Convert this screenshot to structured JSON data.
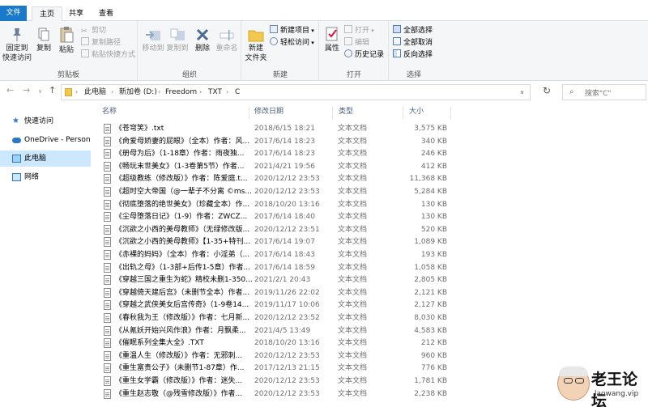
{
  "ribbon_tabs": {
    "file": "文件",
    "home": "主页",
    "share": "共享",
    "view": "查看"
  },
  "ribbon": {
    "clipboard": {
      "label": "剪贴板",
      "pin": "固定到\n快速访问",
      "copy": "复制",
      "paste": "粘贴",
      "cut": "剪切",
      "copy_path": "复制路径",
      "paste_shortcut": "粘贴快捷方式"
    },
    "organize": {
      "label": "组织",
      "move_to": "移动到",
      "copy_to": "复制到",
      "delete": "删除",
      "rename": "重命名"
    },
    "new": {
      "label": "新建",
      "new_folder": "新建\n文件夹",
      "new_item": "新建项目",
      "easy_access": "轻松访问"
    },
    "open": {
      "label": "打开",
      "properties": "属性",
      "open": "打开",
      "edit": "编辑",
      "history": "历史记录"
    },
    "select": {
      "label": "选择",
      "select_all": "全部选择",
      "select_none": "全部取消",
      "invert": "反向选择"
    }
  },
  "address": {
    "crumbs": [
      "此电脑",
      "新加卷 (D:)",
      "Freedom",
      "TXT",
      "C"
    ],
    "search_placeholder": "搜索\"C\""
  },
  "sidebar": {
    "items": [
      {
        "label": "快速访问",
        "icon": "star-icon"
      },
      {
        "label": "OneDrive - Personal",
        "icon": "cloud-icon"
      },
      {
        "label": "此电脑",
        "icon": "computer-icon",
        "selected": true
      },
      {
        "label": "网络",
        "icon": "network-icon"
      }
    ]
  },
  "columns": {
    "name": "名称",
    "date": "修改日期",
    "type": "类型",
    "size": "大小"
  },
  "files": [
    {
      "name": "《苍穹笑》.txt",
      "date": "2018/6/15 18:21",
      "type": "文本文档",
      "size": "3,575 KB"
    },
    {
      "name": "《肏爱母娇妻的屁眼》（全本）作者：风...",
      "date": "2017/6/14 18:23",
      "type": "文本文档",
      "size": "340 KB"
    },
    {
      "name": "《册母为后》（1-18章）作者：雨夜独...",
      "date": "2017/6/14 18:23",
      "type": "文本文档",
      "size": "246 KB"
    },
    {
      "name": "《畅玩末世美女》（1-3卷第5节）作者...",
      "date": "2021/4/21 19:56",
      "type": "文本文档",
      "size": "412 KB"
    },
    {
      "name": "《超级教练（修改版）》作者：陈爱庭.t...",
      "date": "2020/12/12 23:53",
      "type": "文本文档",
      "size": "11,368 KB"
    },
    {
      "name": "《超时空大帝国（@一辈子不分离 ©ms...",
      "date": "2020/12/12 23:53",
      "type": "文本文档",
      "size": "5,284 KB"
    },
    {
      "name": "《彻底堕落的绝世美女》（珍藏全本）作...",
      "date": "2018/10/20 13:16",
      "type": "文本文档",
      "size": "130 KB"
    },
    {
      "name": "《尘母堕落日记》（1-9）作者：ZWCZ...",
      "date": "2017/6/14 18:40",
      "type": "文本文档",
      "size": "130 KB"
    },
    {
      "name": "《沉欲之小西的美母教师》（无绿修改版...",
      "date": "2020/12/12 23:51",
      "type": "文本文档",
      "size": "520 KB"
    },
    {
      "name": "《沉欲之小西的美母教师》【1-35+特刊...",
      "date": "2017/6/14 19:07",
      "type": "文本文档",
      "size": "1,089 KB"
    },
    {
      "name": "《赤裸的妈妈》（全本）作者：小淫弟（...",
      "date": "2017/6/14 18:43",
      "type": "文本文档",
      "size": "193 KB"
    },
    {
      "name": "《出轨之母》（1-3部+后传1-5章）作者...",
      "date": "2017/6/14 18:59",
      "type": "文本文档",
      "size": "1,058 KB"
    },
    {
      "name": "《穿越三国之重生为蛇》精校未删1-350...",
      "date": "2021/2/1 20:43",
      "type": "文本文档",
      "size": "2,805 KB"
    },
    {
      "name": "《穿越倚天建后宫》（未删节全本）作者...",
      "date": "2019/11/26 22:02",
      "type": "文本文档",
      "size": "2,121 KB"
    },
    {
      "name": "《穿越之武侠美女后宫传奇》（1-9卷14...",
      "date": "2019/11/17 10:06",
      "type": "文本文档",
      "size": "2,127 KB"
    },
    {
      "name": "《春秋我为王（修改版）》作者：七月新...",
      "date": "2020/12/12 23:52",
      "type": "文本文档",
      "size": "8,030 KB"
    },
    {
      "name": "《从氪妖开始兴风作浪》作者：月飘柔...",
      "date": "2021/4/5 13:49",
      "type": "文本文档",
      "size": "4,583 KB"
    },
    {
      "name": "《催眠系列全集大全》.TXT",
      "date": "2018/10/20 13:16",
      "type": "文本文档",
      "size": "212 KB"
    },
    {
      "name": "《重温人生（修改版）》作者：无邪刺...",
      "date": "2020/12/12 23:53",
      "type": "文本文档",
      "size": "960 KB"
    },
    {
      "name": "《重生富贵公子》（未删节1-87章）作...",
      "date": "2017/12/13 21:15",
      "type": "文本文档",
      "size": "776 KB"
    },
    {
      "name": "《重生女学霸（修改版）》作者：迷失...",
      "date": "2020/12/12 23:53",
      "type": "文本文档",
      "size": "1,781 KB"
    },
    {
      "name": "《重生赵志敬（@残雪修改版）》作者...",
      "date": "2020/12/12 23:53",
      "type": "文本文档",
      "size": "2,238 KB"
    }
  ],
  "watermark": {
    "title": "老王论坛",
    "url": "laowang.vip"
  }
}
